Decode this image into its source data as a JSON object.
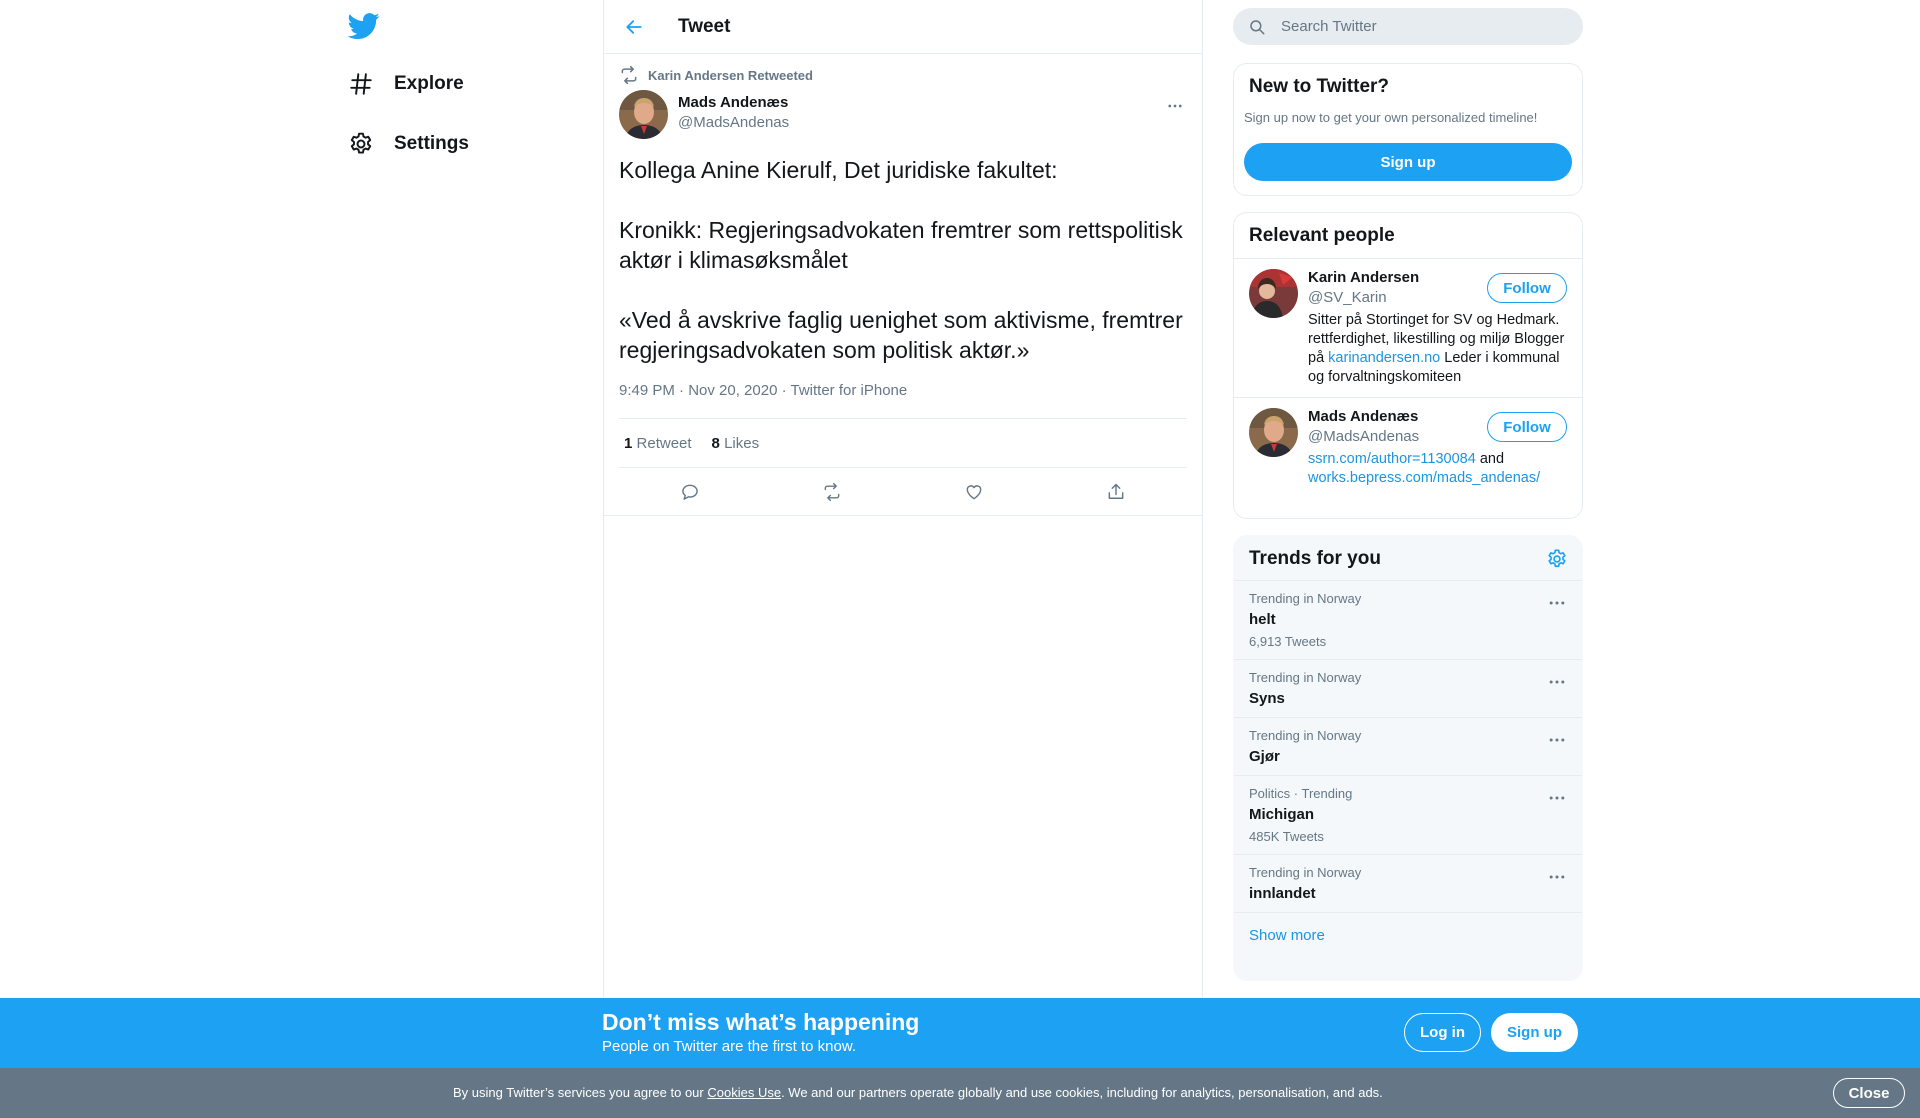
{
  "nav": {
    "explore": "Explore",
    "settings": "Settings"
  },
  "center": {
    "title": "Tweet"
  },
  "tweet": {
    "retweeted_by": "Karin Andersen Retweeted",
    "author_name": "Mads Andenæs",
    "author_handle": "@MadsAndenas",
    "text": "Kollega Anine Kierulf, Det juridiske fakultet:\n\nKronikk: Regjeringsadvokaten fremtrer som rettspolitisk aktør i klimasøksmålet\n\n«Ved å avskrive faglig uenighet som aktivisme, fremtrer regjeringsadvokaten som politisk aktør.»",
    "time": "9:49 PM · Nov 20, 2020",
    "separator": " · ",
    "source": "Twitter for iPhone",
    "retweet_count": "1",
    "retweet_label": "Retweet",
    "like_count": "8",
    "like_label": "Likes"
  },
  "search": {
    "placeholder": "Search Twitter"
  },
  "new_to_twitter": {
    "title": "New to Twitter?",
    "subtitle": "Sign up now to get your own personalized timeline!",
    "signup_label": "Sign up"
  },
  "relevant_people": {
    "title": "Relevant people",
    "people": [
      {
        "name": "Karin Andersen",
        "handle": "@SV_Karin",
        "follow_label": "Follow",
        "bio_before": "Sitter på Stortinget for SV og Hedmark. rettferdighet, likestilling og miljø Blogger på ",
        "bio_link": "karinandersen.no",
        "bio_after": " Leder i kommunal og forvaltningskomiteen"
      },
      {
        "name": "Mads Andenæs",
        "handle": "@MadsAndenas",
        "follow_label": "Follow",
        "bio_link1": "ssrn.com/author=1130084",
        "bio_mid": " and ",
        "bio_link2": "works.bepress.com/mads_andenas/"
      }
    ]
  },
  "trends": {
    "title": "Trends for you",
    "items": [
      {
        "context": "Trending in Norway",
        "name": "helt",
        "count": "6,913 Tweets"
      },
      {
        "context": "Trending in Norway",
        "name": "Syns",
        "count": ""
      },
      {
        "context": "Trending in Norway",
        "name": "Gjør",
        "count": ""
      },
      {
        "context": "Politics · Trending",
        "name": "Michigan",
        "count": "485K Tweets"
      },
      {
        "context": "Trending in Norway",
        "name": "innlandet",
        "count": ""
      }
    ],
    "show_more": "Show more"
  },
  "signup_bar": {
    "title": "Don’t miss what’s happening",
    "subtitle": "People on Twitter are the first to know.",
    "login_label": "Log in",
    "signup_label": "Sign up"
  },
  "cookie_bar": {
    "text_before": "By using Twitter’s services you agree to our ",
    "link": "Cookies Use",
    "text_after": ". We and our partners operate globally and use cookies, including for analytics, personalisation, and ads.",
    "close_label": "Close"
  },
  "colors": {
    "brand_blue": "#1da1f2",
    "link_blue": "#1b95e0",
    "secondary_text": "#657786",
    "border": "#e6ecf0"
  }
}
